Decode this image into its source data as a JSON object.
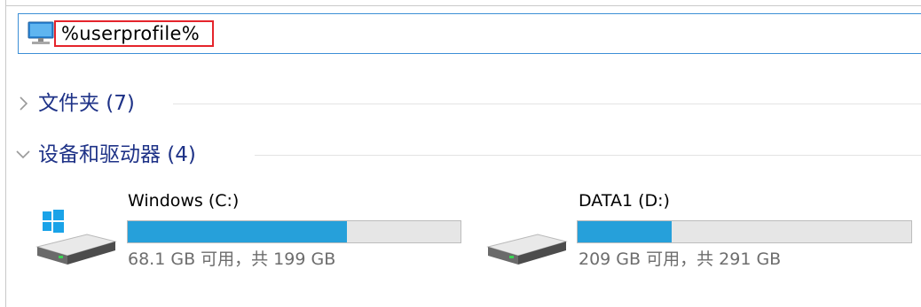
{
  "address_bar": {
    "path": "%userprofile%",
    "icon": "this-pc-icon"
  },
  "groups": [
    {
      "label": "文件夹 (7)",
      "expanded": false,
      "icon": "chevron-right-icon"
    },
    {
      "label": "设备和驱动器 (4)",
      "expanded": true,
      "icon": "chevron-down-icon"
    }
  ],
  "drives": [
    {
      "name": "Windows (C:)",
      "space": "68.1 GB 可用，共 199 GB",
      "used_fraction": 0.658,
      "icon": "system-drive-icon"
    },
    {
      "name": "DATA1 (D:)",
      "space": "209 GB 可用，共 291 GB",
      "used_fraction": 0.282,
      "icon": "hard-drive-icon"
    }
  ],
  "colors": {
    "usage_fill": "#26a0da",
    "usage_track": "#e6e6e6",
    "group_header_text": "#1e3287",
    "address_highlight": "#e5242b",
    "address_border": "#3c8fd6"
  }
}
